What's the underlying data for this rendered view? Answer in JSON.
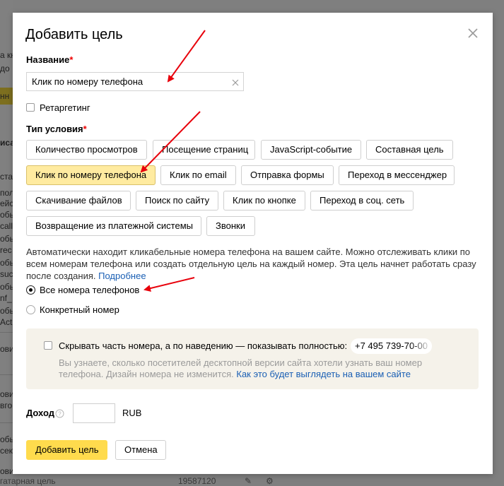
{
  "background": {
    "left_fragments": [
      "а кн",
      "до",
      "нн",
      "иса",
      "стан",
      "пол",
      "ейст",
      "обы",
      "call",
      "обы",
      "rec",
      "обы",
      "suc",
      "обы",
      "nf_",
      "обы",
      "Act",
      "ови",
      "ови",
      "вго",
      "обы",
      "сек",
      "ови"
    ],
    "bottom_fragments": [
      "гатарная цель",
      "19587120"
    ]
  },
  "modal": {
    "title": "Добавить цель",
    "name_label": "Название",
    "name_required_mark": "*",
    "name_value": "Клик по номеру телефона",
    "retargeting_label": "Ретаргетинг",
    "condition_label": "Тип условия",
    "condition_required_mark": "*",
    "conditions": [
      "Количество просмотров",
      "Посещение страниц",
      "JavaScript-событие",
      "Составная цель",
      "Клик по номеру телефона",
      "Клик по email",
      "Отправка формы",
      "Переход в мессенджер",
      "Скачивание файлов",
      "Поиск по сайту",
      "Клик по кнопке",
      "Переход в соц. сеть",
      "Возвращение из платежной системы",
      "Звонки"
    ],
    "active_condition": "Клик по номеру телефона",
    "description": "Автоматически находит кликабельные номера телефона на вашем сайте. Можно отслеживать клики по всем номерам телефона или создать отдельную цель на каждый номер. Эта цель начнет работать сразу после создания.",
    "description_link": "Подробнее",
    "radio_all": "Все номера телефонов",
    "radio_specific": "Конкретный номер",
    "hide_label": "Скрывать часть номера, а по наведению — показывать полностью:",
    "phone_example": "+7 495 739-70-00",
    "hide_note": "Вы узнаете, сколько посетителей десктопной версии сайта хотели узнать ваш номер телефона. Дизайн номера не изменится.",
    "hide_note_link": "Как это будет выглядеть на вашем сайте",
    "income_label": "Доход",
    "currency": "RUB",
    "submit_label": "Добавить цель",
    "cancel_label": "Отмена"
  },
  "colors": {
    "accent_yellow": "#ffdb4d",
    "active_chip": "#ffeba0",
    "link_blue": "#1a5fb4",
    "required_red": "#e00000",
    "arrow_red": "#e8000b"
  },
  "icons": [
    "close-icon",
    "clear-input-icon",
    "info-icon",
    "red-arrow"
  ]
}
